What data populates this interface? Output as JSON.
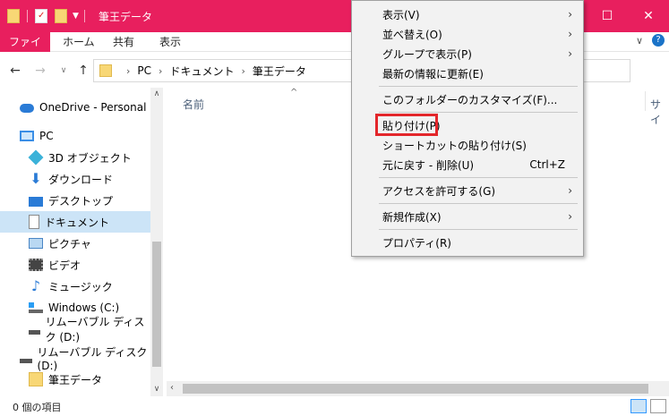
{
  "window": {
    "title": "筆王データ",
    "minimize_glyph": "—",
    "maximize_glyph": "☐",
    "close_glyph": "✕"
  },
  "ribbon": {
    "tabs": [
      "ファイル",
      "ホーム",
      "共有",
      "表示"
    ]
  },
  "address": {
    "path": [
      "PC",
      "ドキュメント",
      "筆王データ"
    ]
  },
  "sidebar": {
    "items": [
      {
        "label": "OneDrive - Personal",
        "icon": "cloud-icon"
      },
      {
        "label": "PC",
        "icon": "pc-icon"
      },
      {
        "label": "3D オブジェクト",
        "icon": "cube-icon"
      },
      {
        "label": "ダウンロード",
        "icon": "download-icon"
      },
      {
        "label": "デスクトップ",
        "icon": "desktop-icon"
      },
      {
        "label": "ドキュメント",
        "icon": "document-icon",
        "selected": true
      },
      {
        "label": "ピクチャ",
        "icon": "picture-icon"
      },
      {
        "label": "ビデオ",
        "icon": "video-icon"
      },
      {
        "label": "ミュージック",
        "icon": "music-icon"
      },
      {
        "label": "Windows (C:)",
        "icon": "drive-icon"
      },
      {
        "label": "リムーバブル ディスク (D:)",
        "icon": "removable-disk-icon"
      },
      {
        "label": "リムーバブル ディスク (D:)",
        "icon": "removable-disk-icon"
      },
      {
        "label": "筆王データ",
        "icon": "folder-icon"
      }
    ]
  },
  "content": {
    "column_name": "名前",
    "column_size_partial": "サイ"
  },
  "status": {
    "item_count": "0 個の項目"
  },
  "context_menu": {
    "items": [
      {
        "label": "表示(V)",
        "submenu": true
      },
      {
        "label": "並べ替え(O)",
        "submenu": true
      },
      {
        "label": "グループで表示(P)",
        "submenu": true
      },
      {
        "label": "最新の情報に更新(E)"
      },
      {
        "label": "このフォルダーのカスタマイズ(F)..."
      },
      {
        "label": "貼り付け(P)",
        "highlighted": true
      },
      {
        "label": "ショートカットの貼り付け(S)"
      },
      {
        "label": "元に戻す - 削除(U)",
        "shortcut": "Ctrl+Z"
      },
      {
        "label": "アクセスを許可する(G)",
        "submenu": true
      },
      {
        "label": "新規作成(X)",
        "submenu": true
      },
      {
        "label": "プロパティ(R)"
      }
    ]
  },
  "colors": {
    "titlebar": "#e81f5e",
    "selection": "#cce4f7",
    "highlight_box": "#e3262b"
  }
}
